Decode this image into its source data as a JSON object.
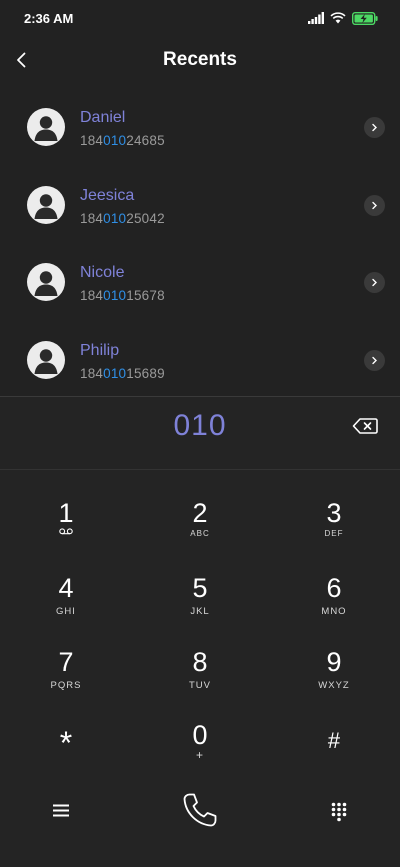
{
  "status_bar": {
    "time": "2:36 AM"
  },
  "header": {
    "title": "Recents"
  },
  "recents": [
    {
      "name": "Daniel",
      "number_prefix": "184",
      "number_match": "010",
      "number_suffix": "24685"
    },
    {
      "name": "Jeesica",
      "number_prefix": "184",
      "number_match": "010",
      "number_suffix": "25042"
    },
    {
      "name": "Nicole",
      "number_prefix": "184",
      "number_match": "010",
      "number_suffix": "15678"
    },
    {
      "name": "Philip",
      "number_prefix": "184",
      "number_match": "010",
      "number_suffix": "15689"
    }
  ],
  "dial": {
    "entered": "010"
  },
  "keypad": [
    {
      "digit": "1",
      "letters": "",
      "icon": "voicemail-icon"
    },
    {
      "digit": "2",
      "letters": "ABC"
    },
    {
      "digit": "3",
      "letters": "DEF"
    },
    {
      "digit": "4",
      "letters": "GHI"
    },
    {
      "digit": "5",
      "letters": "JKL"
    },
    {
      "digit": "6",
      "letters": "MNO"
    },
    {
      "digit": "7",
      "letters": "PQRS"
    },
    {
      "digit": "8",
      "letters": "TUV"
    },
    {
      "digit": "9",
      "letters": "WXYZ"
    },
    {
      "digit": "*",
      "letters": ""
    },
    {
      "digit": "0",
      "letters": "+"
    },
    {
      "digit": "#",
      "letters": ""
    }
  ],
  "colors": {
    "background": "#222222",
    "accent_name": "#7f82d8",
    "match_highlight": "#2f8fe6",
    "battery": "#4cd964"
  }
}
